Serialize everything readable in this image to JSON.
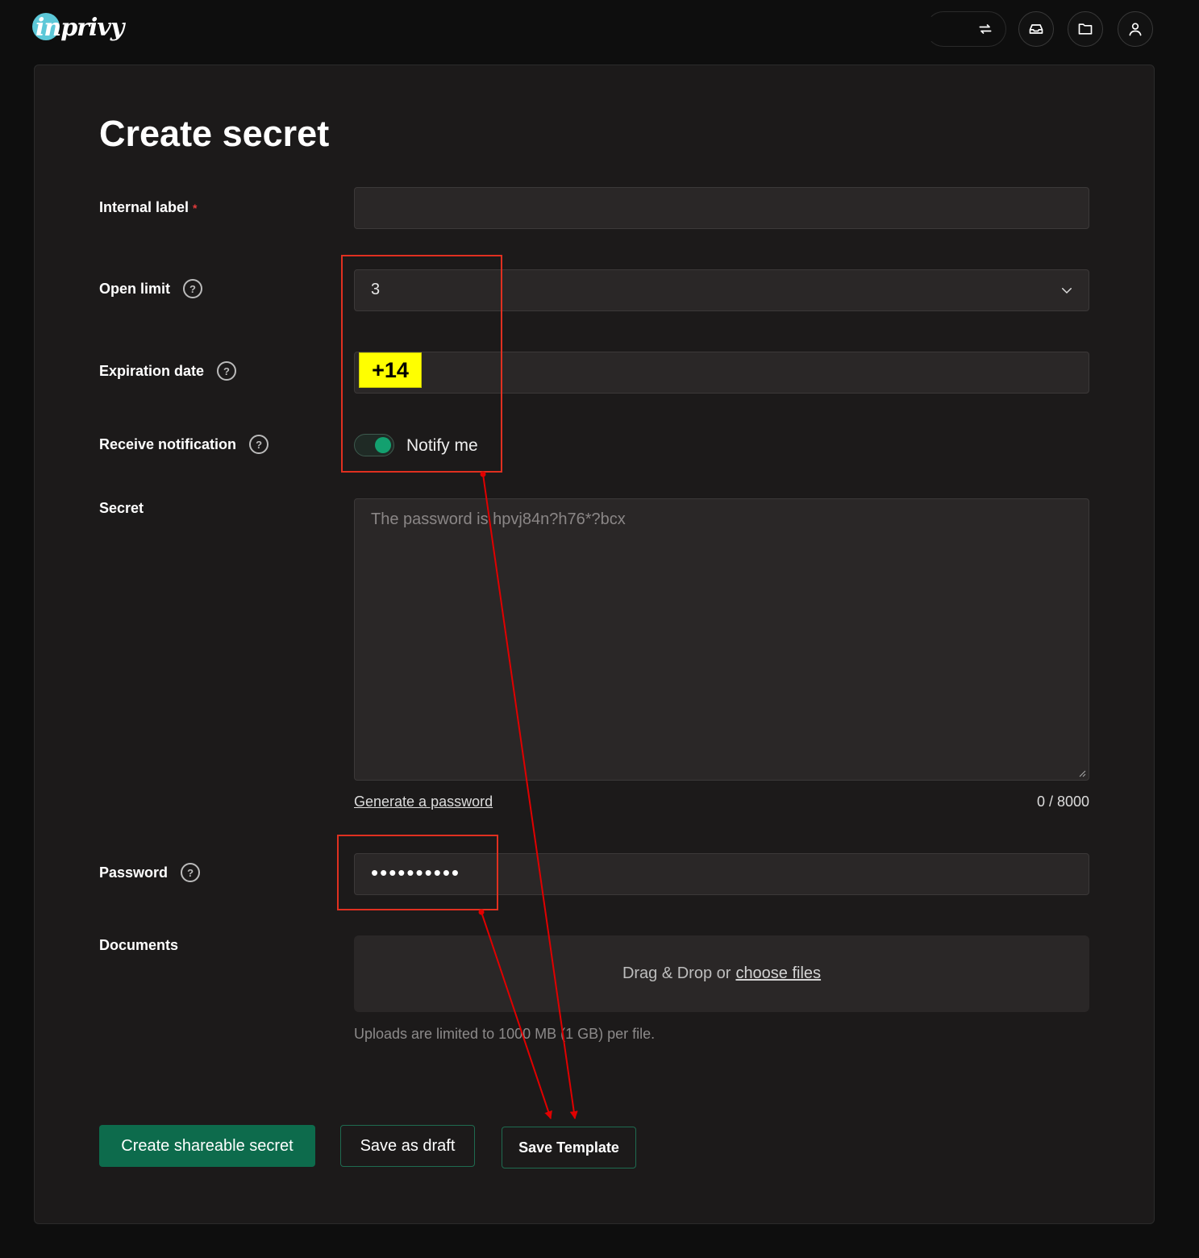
{
  "header": {
    "logo_text": "inprivy",
    "icons": [
      "exchange-icon",
      "inbox-icon",
      "folder-icon",
      "user-icon"
    ]
  },
  "form": {
    "title": "Create secret",
    "internal_label": {
      "label": "Internal label",
      "required_mark": "*",
      "value": ""
    },
    "open_limit": {
      "label": "Open limit",
      "value": "3"
    },
    "expiration_date": {
      "label": "Expiration date",
      "value": ""
    },
    "receive_notification": {
      "label": "Receive notification",
      "toggle_label": "Notify me",
      "enabled": true
    },
    "secret": {
      "label": "Secret",
      "placeholder": "The password is hpvj84n?h76*?bcx",
      "generate_link": "Generate a password",
      "counter": "0 / 8000"
    },
    "password": {
      "label": "Password",
      "masked_value": "••••••••••"
    },
    "documents": {
      "label": "Documents",
      "drop_text": "Drag & Drop or",
      "choose_link": "choose files",
      "note": "Uploads are limited to 1000 MB (1 GB) per file."
    },
    "buttons": {
      "create": "Create shareable secret",
      "draft": "Save as draft",
      "template": "Save Template"
    }
  },
  "annotations": {
    "badge": "+14",
    "colors": {
      "box": "#e03020",
      "arrow": "#e00000",
      "badge_bg": "#ffff00"
    }
  },
  "colors": {
    "accent": "#0d6b4c",
    "toggle_on": "#13a06f",
    "background": "#0e0e0e",
    "card": "#1c1a1a"
  }
}
